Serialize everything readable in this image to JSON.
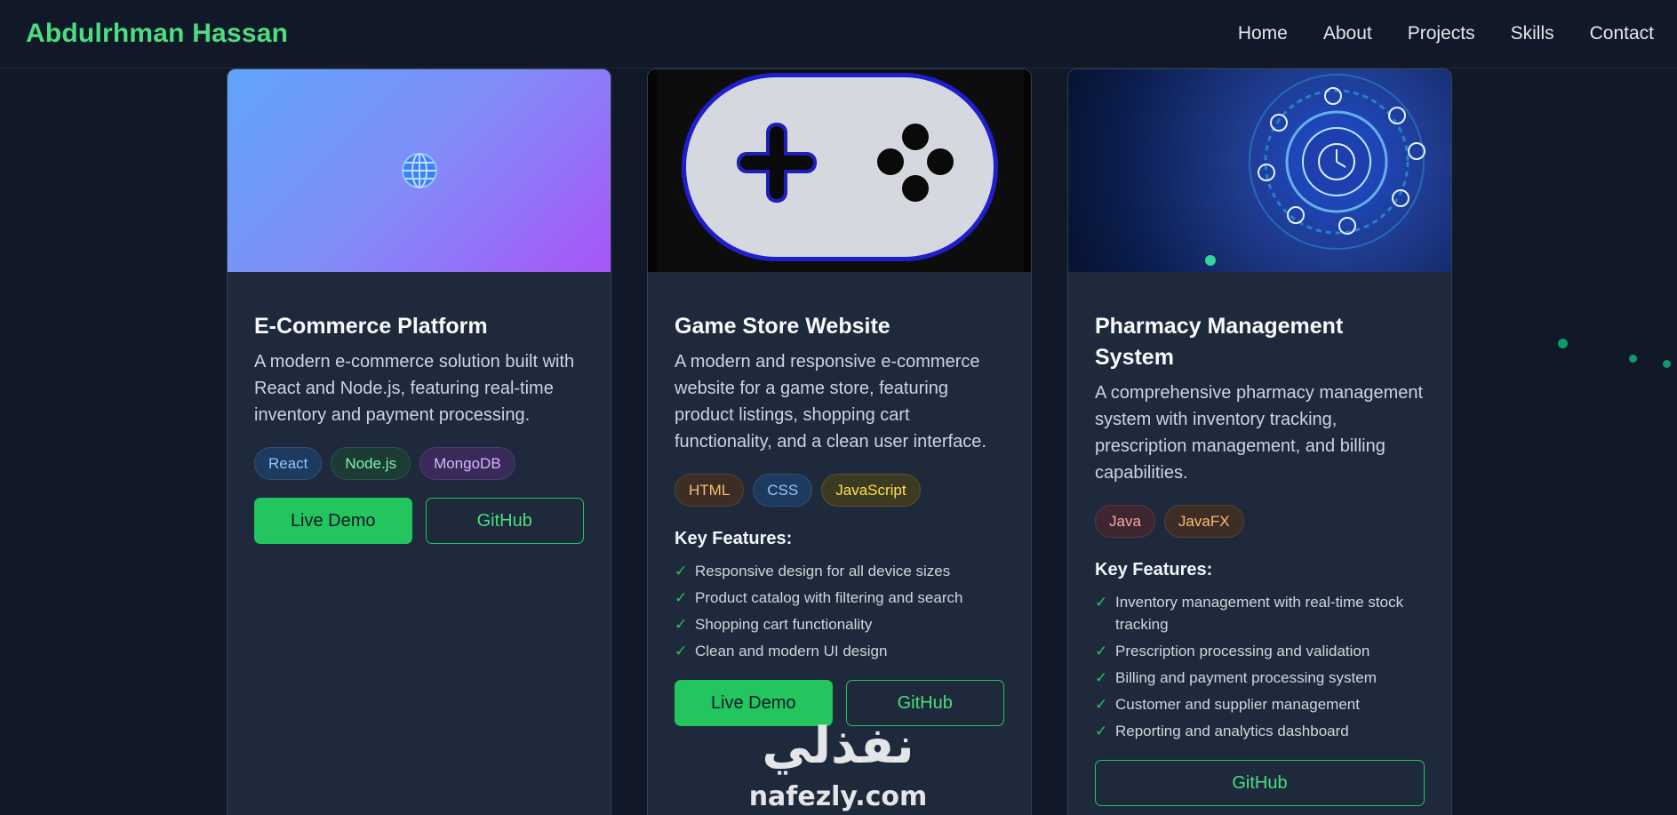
{
  "nav": {
    "brand": "Abdulrhman Hassan",
    "links": [
      "Home",
      "About",
      "Projects",
      "Skills",
      "Contact"
    ]
  },
  "projects": [
    {
      "title": "E-Commerce Platform",
      "description": "A modern e-commerce solution built with React and Node.js, featuring real-time inventory and payment processing.",
      "tags": [
        "React",
        "Node.js",
        "MongoDB"
      ],
      "live_demo": "Live Demo",
      "github": "GitHub"
    },
    {
      "title": "Game Store Website",
      "description": "A modern and responsive e-commerce website for a game store, featuring product listings, shopping cart functionality, and a clean user interface.",
      "tags": [
        "HTML",
        "CSS",
        "JavaScript"
      ],
      "features_title": "Key Features:",
      "features": [
        "Responsive design for all device sizes",
        "Product catalog with filtering and search",
        "Shopping cart functionality",
        "Clean and modern UI design"
      ],
      "live_demo": "Live Demo",
      "github": "GitHub"
    },
    {
      "title": "Pharmacy Management System",
      "description": "A comprehensive pharmacy management system with inventory tracking, prescription management, and billing capabilities.",
      "tags": [
        "Java",
        "JavaFX"
      ],
      "features_title": "Key Features:",
      "features": [
        "Inventory management with real-time stock tracking",
        "Prescription processing and validation",
        "Billing and payment processing system",
        "Customer and supplier management",
        "Reporting and analytics dashboard"
      ],
      "github": "GitHub"
    }
  ],
  "watermark": {
    "arabic": "نفذلي",
    "latin": "nafezly.com"
  },
  "colors": {
    "background": "#111827",
    "card": "#1e293b",
    "accent": "#22c55e",
    "brand": "#4ade80"
  }
}
